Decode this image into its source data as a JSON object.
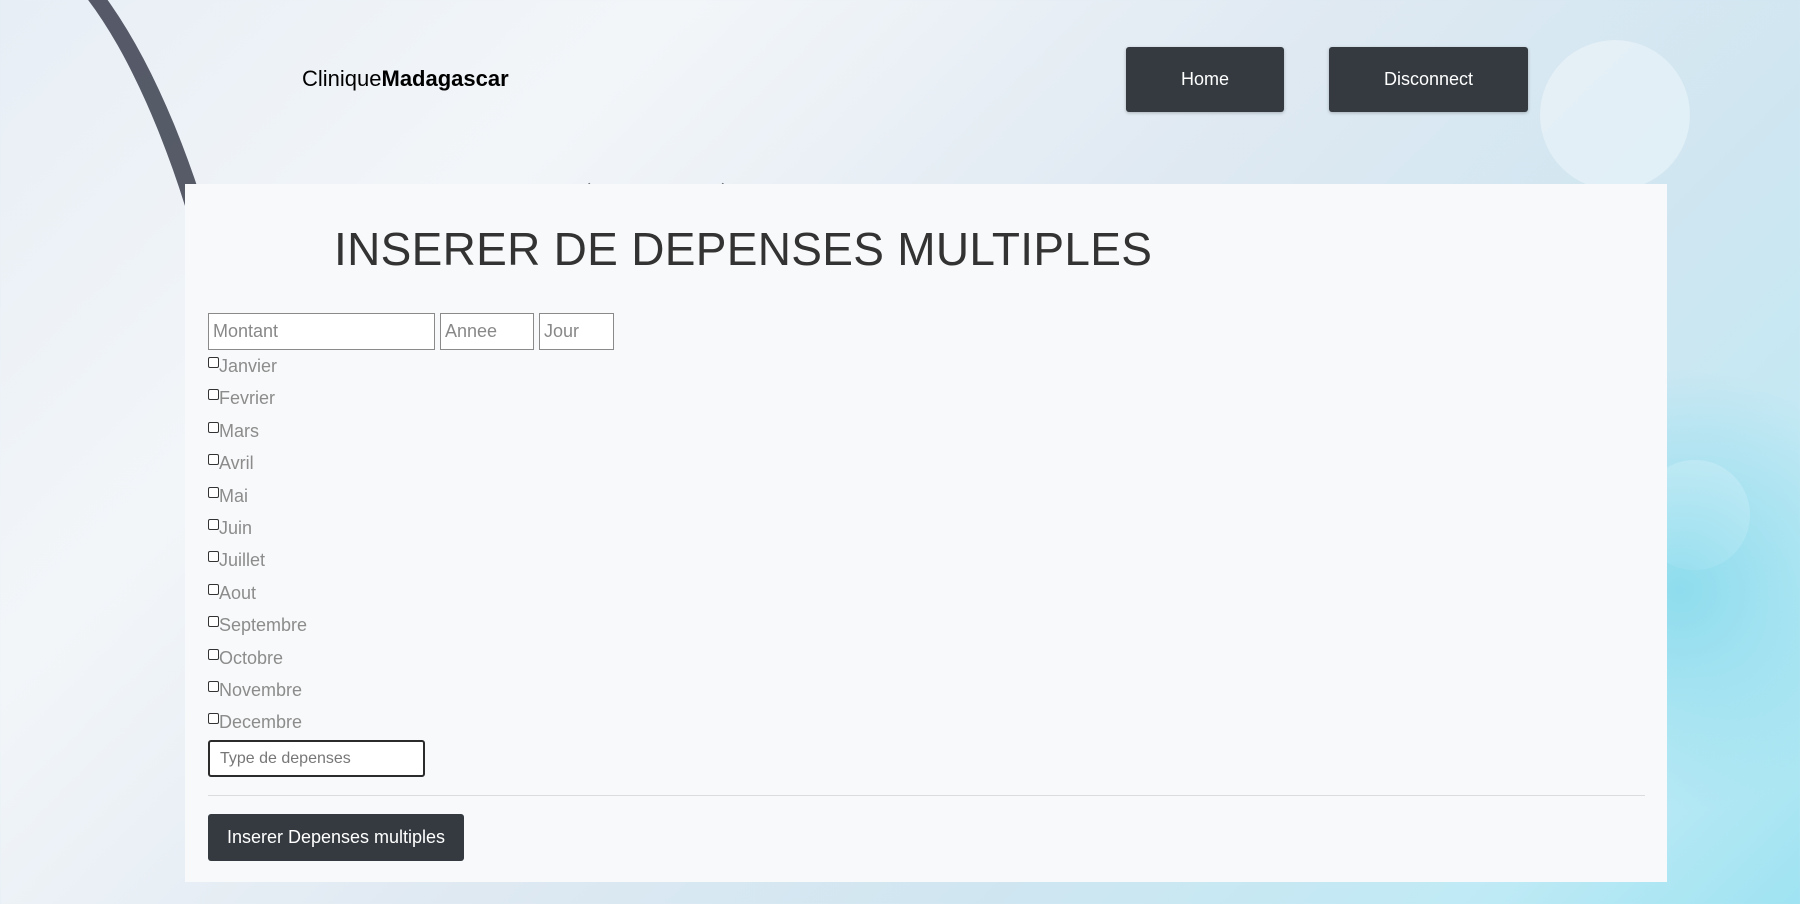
{
  "brand": {
    "prefix": "Clinique",
    "name": "Madagascar"
  },
  "nav": {
    "home_label": "Home",
    "disconnect_label": "Disconnect"
  },
  "form": {
    "title": "INSERER DE DEPENSES MULTIPLES",
    "montant_placeholder": "Montant",
    "annee_placeholder": "Annee",
    "jour_placeholder": "Jour",
    "months": [
      "Janvier",
      "Fevrier",
      "Mars",
      "Avril",
      "Mai",
      "Juin",
      "Juillet",
      "Aout",
      "Septembre",
      "Octobre",
      "Novembre",
      "Decembre"
    ],
    "type_placeholder": "Type de depenses",
    "submit_label": "Inserer Depenses multiples"
  },
  "colors": {
    "button_bg": "#343a40",
    "panel_bg": "#f8f9fa"
  }
}
